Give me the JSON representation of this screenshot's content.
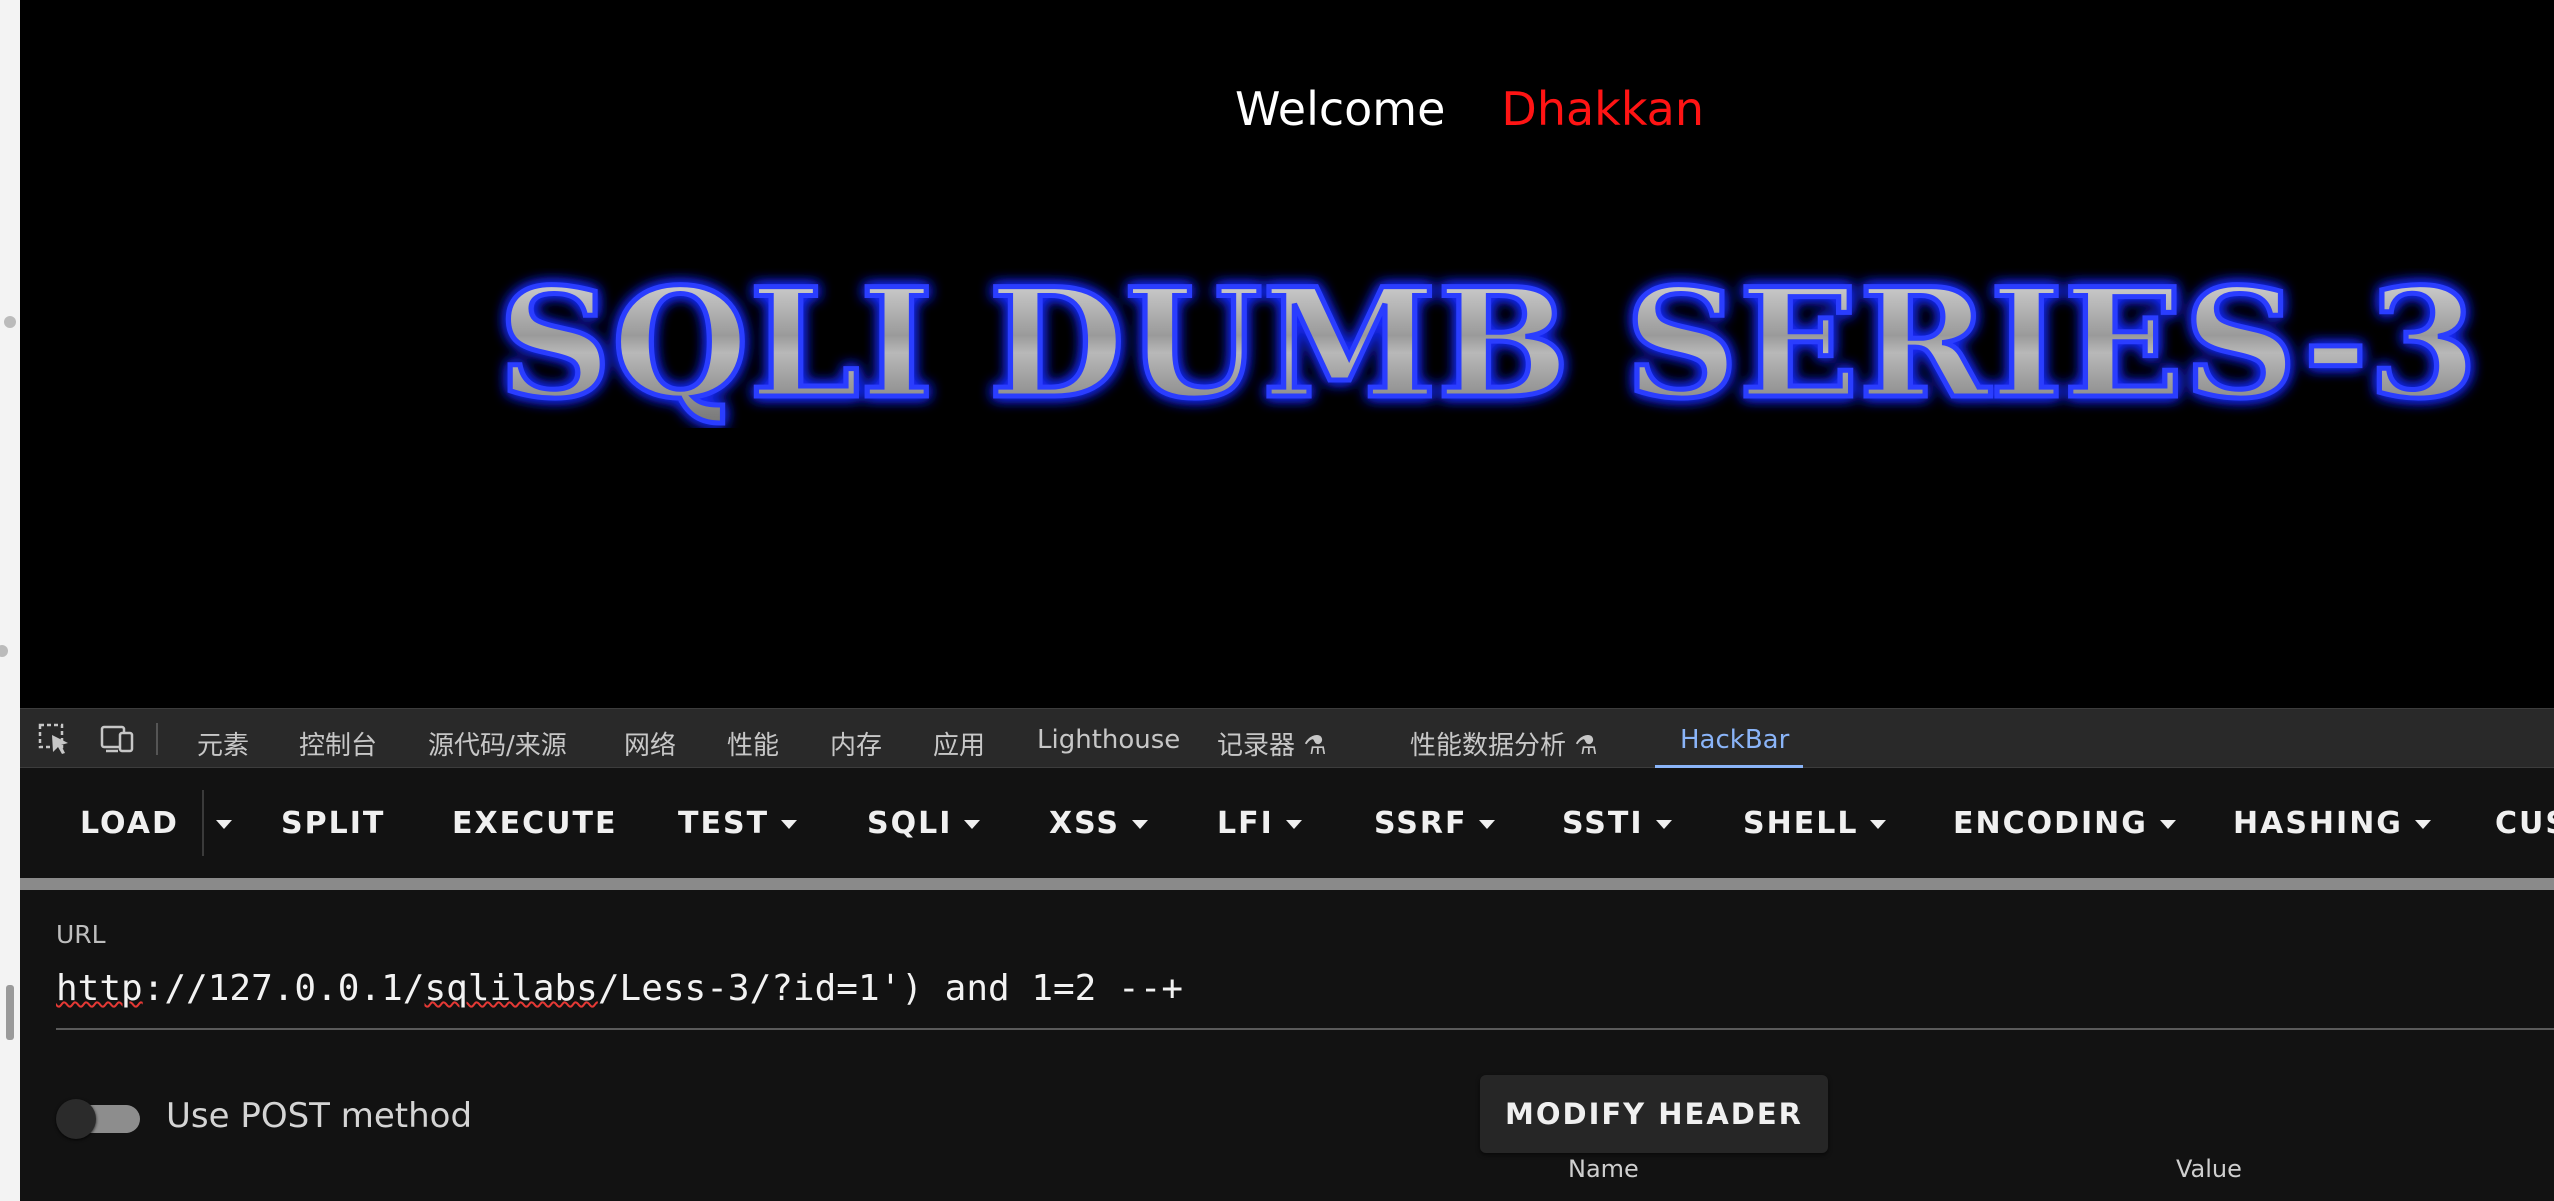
{
  "page": {
    "welcome_text": "Welcome",
    "user_name": "Dhakkan",
    "banner_title": "SQLI DUMB SERIES-3"
  },
  "devtools": {
    "tabs": [
      "元素",
      "控制台",
      "源代码/来源",
      "网络",
      "性能",
      "内存",
      "应用",
      "Lighthouse",
      "记录器 ⚗",
      "性能数据分析 ⚗",
      "HackBar"
    ],
    "active_tab": "HackBar"
  },
  "hackbar": {
    "toolbar": {
      "load": "LOAD",
      "split": "SPLIT",
      "execute": "EXECUTE",
      "test": "TEST",
      "sqli": "SQLI",
      "xss": "XSS",
      "lfi": "LFI",
      "ssrf": "SSRF",
      "ssti": "SSTI",
      "shell": "SHELL",
      "encoding": "ENCODING",
      "hashing": "HASHING",
      "custom": "CUS"
    },
    "url_label": "URL",
    "url_parts": {
      "scheme": "http",
      "middle": "://127.0.0.1/",
      "path_word": "sqlilabs",
      "rest": "/Less-3/?id=1') and 1=2 --+"
    },
    "use_post_label": "Use POST method",
    "use_post_enabled": false,
    "modify_header_label": "MODIFY HEADER",
    "headers_columns": [
      "Name",
      "Value"
    ]
  },
  "colors": {
    "accent_blue": "#8ab4f8",
    "name_red": "#ff1414",
    "banner_glow": "#1a2bff"
  }
}
